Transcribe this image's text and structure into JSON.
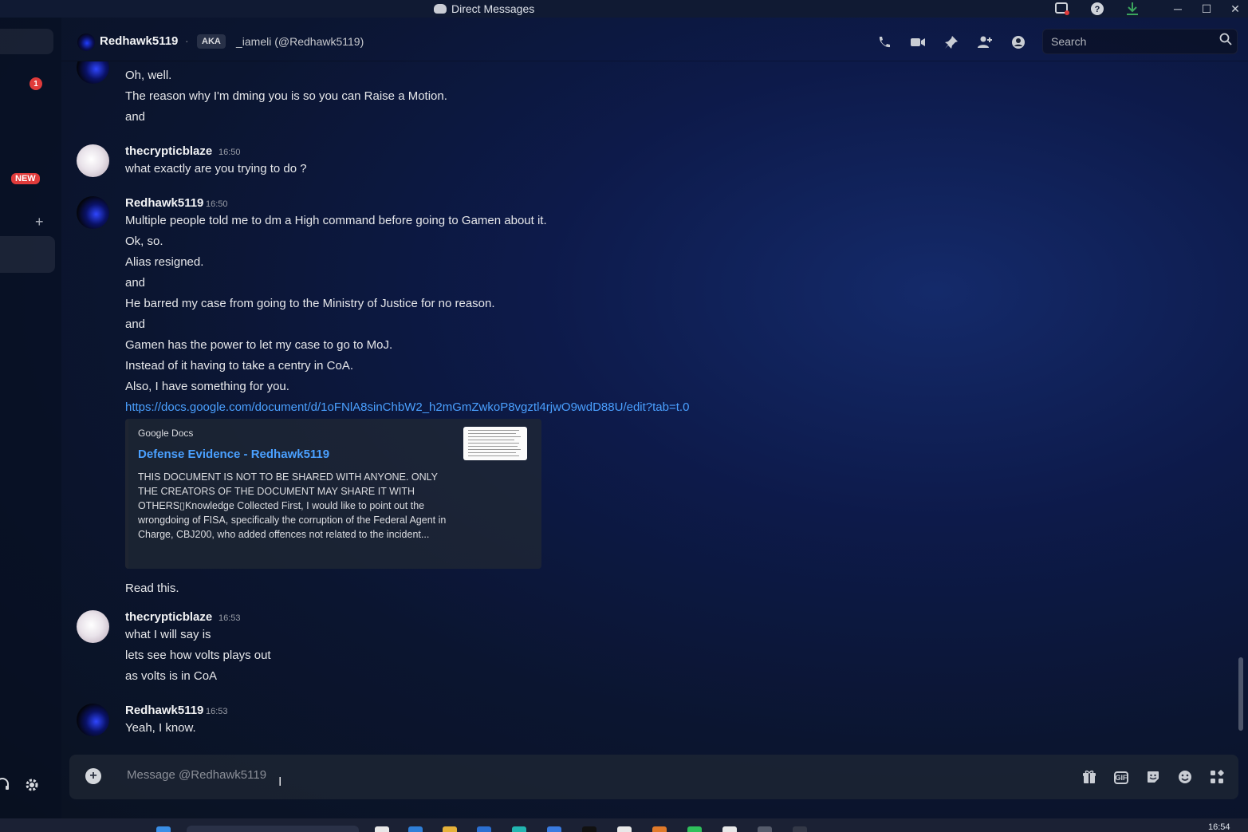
{
  "window": {
    "title": "Direct Messages",
    "controls": [
      "minimize",
      "maximize",
      "close"
    ],
    "minimize_glyph": "─",
    "maximize_glyph": "☐",
    "close_glyph": "✕"
  },
  "sidebar": {
    "unread_badge": "1",
    "new_badge": "NEW",
    "add_glyph": "+"
  },
  "header": {
    "name": "Redhawk5119",
    "separator": "·",
    "aka_badge": "AKA",
    "aka_text": "_iameli (@Redhawk5119)",
    "icons": [
      "phone-icon",
      "video-icon",
      "pin-icon",
      "add-friends-icon",
      "profile-icon"
    ],
    "search_placeholder": "Search"
  },
  "messages": {
    "top_partial_lines": [
      "Oh, well.",
      "The reason why I'm dming you is so you can Raise a Motion.",
      "and"
    ],
    "groups": [
      {
        "author": "thecrypticblaze",
        "time": "16:50",
        "lines": [
          "what exactly are you trying to do ?"
        ]
      },
      {
        "author": "Redhawk5119",
        "time": "16:50",
        "lines": [
          "Multiple people told me to dm a High command before going to Gamen about it.",
          "Ok, so.",
          "Alias resigned.",
          "and",
          "He barred my case from going to the Ministry of Justice for no reason.",
          "and",
          "Gamen has the power to let my case to go to MoJ.",
          "Instead of it having to take a centry in CoA.",
          "Also, I have something for you."
        ],
        "link": "https://docs.google.com/document/d/1oFNlA8sinChbW2_h2mGmZwkoP8vgztl4rjwO9wdD88U/edit?tab=t.0",
        "embed": {
          "provider": "Google Docs",
          "title": "Defense Evidence - Redhawk5119",
          "description": "THIS DOCUMENT IS NOT TO BE SHARED WITH ANYONE. ONLY THE CREATORS OF THE DOCUMENT MAY SHARE IT WITH OTHERS▯Knowledge Collected First, I would like to point out the wrongdoing of FISA, specifically the corruption of the Federal Agent in Charge, CBJ200, who added offences not related to the incident..."
        },
        "after_embed": "Read this."
      },
      {
        "author": "thecrypticblaze",
        "time": "16:53",
        "lines": [
          "what I will say is",
          "lets see how volts plays out",
          "as volts is in CoA"
        ]
      },
      {
        "author": "Redhawk5119",
        "time": "16:53",
        "lines": [
          "Yeah, I know."
        ]
      }
    ]
  },
  "composer": {
    "placeholder": "Message @Redhawk5119",
    "plus_glyph": "+",
    "gif_label": "GIF",
    "icons": [
      "gift-icon",
      "gif-icon",
      "sticker-icon",
      "emoji-icon",
      "apps-icon"
    ]
  },
  "taskbar": {
    "time": "16:54"
  },
  "colors": {
    "link": "#4aa0ff",
    "badge": "#e03b3b",
    "download": "#3ba55d"
  }
}
